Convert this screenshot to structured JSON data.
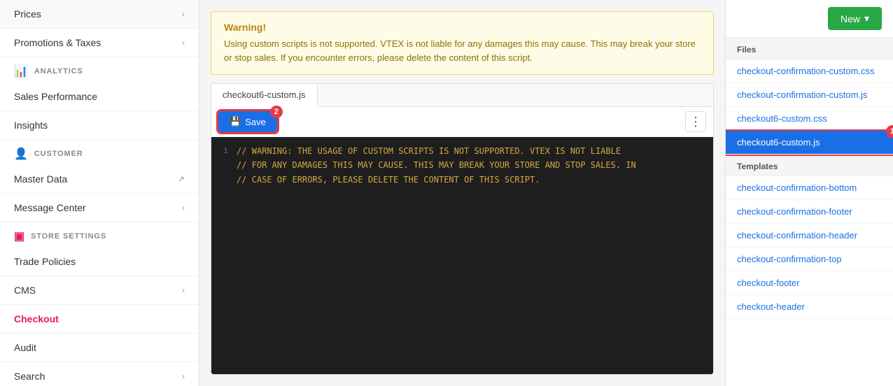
{
  "sidebar": {
    "items_top": [
      {
        "label": "Prices",
        "hasChevron": true
      },
      {
        "label": "Promotions & Taxes",
        "hasChevron": true
      }
    ],
    "analytics_section": "ANALYTICS",
    "analytics_items": [
      {
        "label": "Sales Performance",
        "hasChevron": false
      },
      {
        "label": "Insights",
        "hasChevron": false
      }
    ],
    "customer_section": "CUSTOMER",
    "customer_items": [
      {
        "label": "Master Data",
        "hasChevron": false,
        "hasExternal": true
      },
      {
        "label": "Message Center",
        "hasChevron": true
      }
    ],
    "store_settings_section": "STORE SETTINGS",
    "store_settings_items": [
      {
        "label": "Trade Policies",
        "hasChevron": false
      },
      {
        "label": "CMS",
        "hasChevron": true
      },
      {
        "label": "Checkout",
        "hasChevron": false,
        "active": true
      },
      {
        "label": "Audit",
        "hasChevron": false
      },
      {
        "label": "Search",
        "hasChevron": true
      }
    ]
  },
  "warning": {
    "title": "Warning!",
    "text": "Using custom scripts is not supported. VTEX is not liable for any damages this may cause. This may break your store or stop sales. If you encounter errors, please delete the content of this script."
  },
  "editor": {
    "tab_label": "checkout6-custom.js",
    "save_label": "Save",
    "badge_number": "2",
    "code_line_number": "1",
    "code_content": "// WARNING: THE USAGE OF CUSTOM SCRIPTS IS NOT SUPPORTED. VTEX IS NOT LIABLE\n// FOR ANY DAMAGES THIS MAY CAUSE. THIS MAY BREAK YOUR STORE AND STOP SALES. IN\n// CASE OF ERRORS, PLEASE DELETE THE CONTENT OF THIS SCRIPT."
  },
  "right_panel": {
    "new_button_label": "New",
    "files_section_label": "Files",
    "files": [
      {
        "label": "checkout-confirmation-custom.css",
        "selected": false
      },
      {
        "label": "checkout-confirmation-custom.js",
        "selected": false
      },
      {
        "label": "checkout6-custom.css",
        "selected": false
      },
      {
        "label": "checkout6-custom.js",
        "selected": true
      }
    ],
    "templates_section_label": "Templates",
    "templates": [
      {
        "label": "checkout-confirmation-bottom"
      },
      {
        "label": "checkout-confirmation-footer"
      },
      {
        "label": "checkout-confirmation-header"
      },
      {
        "label": "checkout-confirmation-top"
      },
      {
        "label": "checkout-footer"
      },
      {
        "label": "checkout-header"
      }
    ]
  },
  "badge1_label": "1",
  "badge2_label": "2"
}
